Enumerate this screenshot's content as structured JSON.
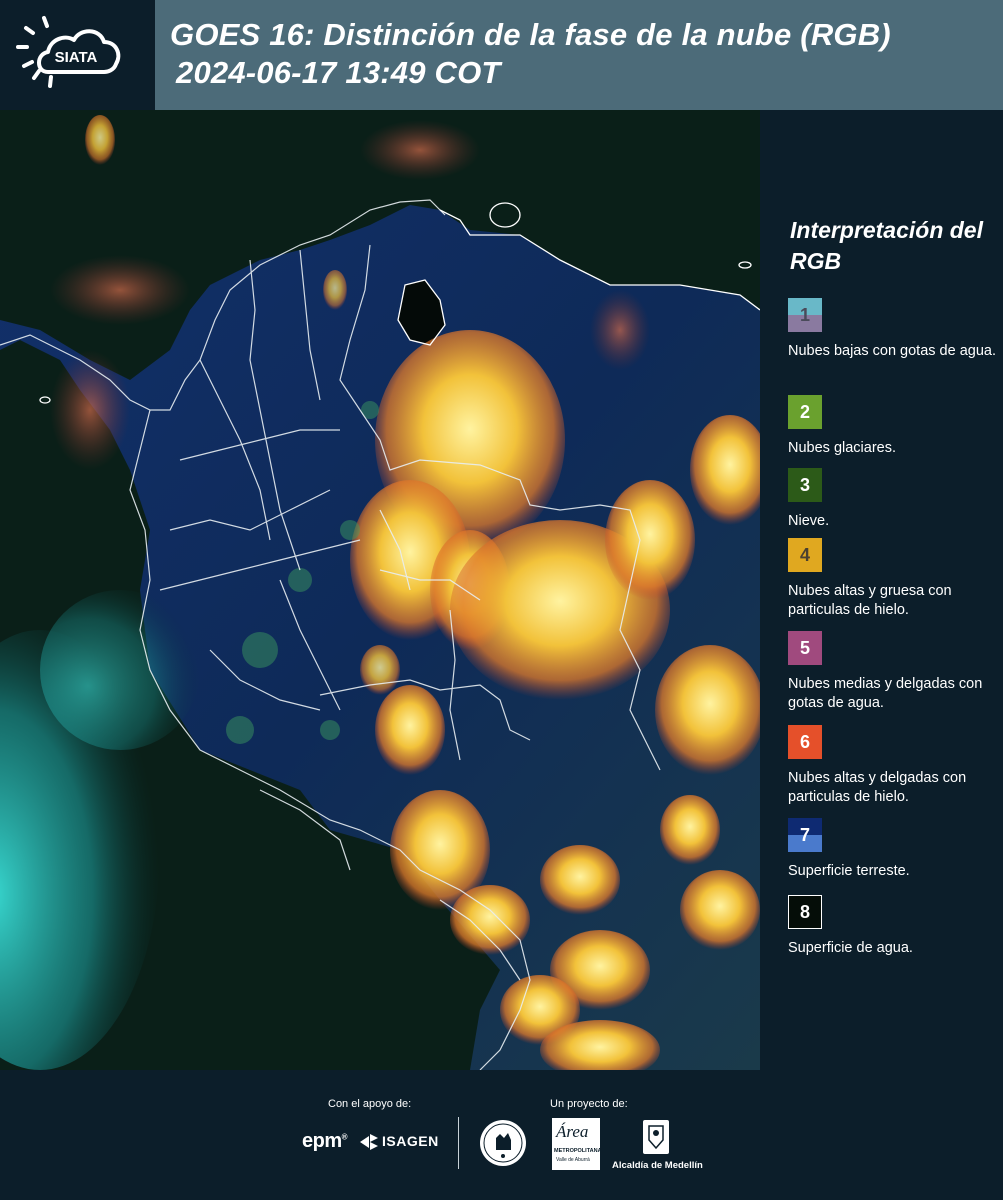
{
  "header": {
    "logo_text": "SIATA",
    "title_line1": "GOES 16: Distinción de la fase de la nube (RGB)",
    "title_line2": "2024-06-17 13:49 COT"
  },
  "legend": {
    "title": "Interpretación del RGB",
    "items": [
      {
        "number": "1",
        "label": "Nubes bajas con gotas de agua.",
        "color_top": "#69b8c8",
        "color_bottom": "#8a7aa0"
      },
      {
        "number": "2",
        "label": "Nubes glaciares.",
        "color": "#6aa12e"
      },
      {
        "number": "3",
        "label": "Nieve.",
        "color": "#2c5a18"
      },
      {
        "number": "4",
        "label": "Nubes altas y gruesa con particulas de hielo.",
        "color": "#e0a820"
      },
      {
        "number": "5",
        "label": "Nubes medias y delgadas con gotas de agua.",
        "color": "#a04a7e"
      },
      {
        "number": "6",
        "label": "Nubes altas y delgadas con particulas de hielo.",
        "color": "#e5502a"
      },
      {
        "number": "7",
        "label": "Superficie terreste.",
        "color_top": "#0e2a72",
        "color_bottom": "#4a7acc"
      },
      {
        "number": "8",
        "label": "Superficie de agua.",
        "color": "#050d08"
      }
    ]
  },
  "footer": {
    "support_caption": "Con el apoyo de:",
    "project_caption": "Un proyecto de:",
    "sponsor_epm": "epm",
    "sponsor_isagen": "ISAGEN",
    "area_metropolitana_name": "Área",
    "area_metropolitana_sub": "METROPOLITANA",
    "area_metropolitana_sub2": "Valle de Aburrá",
    "alcaldia": "Alcaldía de Medellín"
  },
  "colors": {
    "background": "#0c1e2a",
    "header_band": "#4c6b79",
    "map_ocean": "#07140f",
    "map_land": "#10285a",
    "cloud_yellow": "#f2c23a",
    "cloud_orange": "#e07a2a",
    "border_lines": "#e8eef2"
  }
}
